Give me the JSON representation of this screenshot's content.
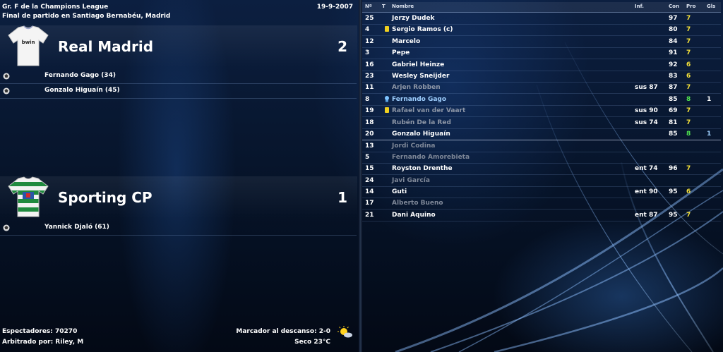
{
  "match": {
    "competition": "Gr. F de la Champions League",
    "subtitle": "Final de partido en Santiago Bernabéu, Madrid",
    "date": "19-9-2007"
  },
  "home": {
    "name": "Real Madrid",
    "score": "2",
    "shirt_icon": "white-shirt-icon",
    "shirt_text": "bwin",
    "events": [
      {
        "text": "Fernando Gago (34)",
        "icon": "goal-ball-icon"
      },
      {
        "text": "Gonzalo Higuaín (45)",
        "icon": "goal-ball-icon"
      }
    ]
  },
  "away": {
    "name": "Sporting CP",
    "score": "1",
    "shirt_icon": "green-hooped-shirt-icon",
    "events": [
      {
        "text": "Yannick Djaló (61)",
        "icon": "goal-ball-icon"
      }
    ]
  },
  "footer": {
    "spectators": "Espectadores: 70270",
    "referee": "Arbitrado por: Riley, M",
    "halftime": "Marcador al descanso: 2-0",
    "weather": "Seco 23°C",
    "weather_icon": "sun-cloud-icon"
  },
  "table": {
    "headers": {
      "num": "Nº",
      "t": "T",
      "name": "Nombre",
      "inf": "Inf.",
      "con": "Con",
      "pro": "Pro",
      "gls": "Gls"
    },
    "rows": [
      {
        "num": "25",
        "name": "Jerzy Dudek",
        "inf": "",
        "con": "97",
        "pro": "7",
        "gls": "",
        "state": "normal",
        "icon": ""
      },
      {
        "num": "4",
        "name": "Sergio Ramos (c)",
        "inf": "",
        "con": "80",
        "pro": "7",
        "gls": "",
        "state": "normal",
        "icon": "yellow-card-icon"
      },
      {
        "num": "12",
        "name": "Marcelo",
        "inf": "",
        "con": "84",
        "pro": "7",
        "gls": "",
        "state": "normal",
        "icon": ""
      },
      {
        "num": "3",
        "name": "Pepe",
        "inf": "",
        "con": "91",
        "pro": "7",
        "gls": "",
        "state": "normal",
        "icon": ""
      },
      {
        "num": "16",
        "name": "Gabriel Heinze",
        "inf": "",
        "con": "92",
        "pro": "6",
        "gls": "",
        "state": "normal",
        "icon": ""
      },
      {
        "num": "23",
        "name": "Wesley Sneijder",
        "inf": "",
        "con": "83",
        "pro": "6",
        "gls": "",
        "state": "normal",
        "icon": ""
      },
      {
        "num": "11",
        "name": "Arjen Robben",
        "inf": "sus 87",
        "con": "87",
        "pro": "7",
        "gls": "",
        "state": "sub-out",
        "icon": ""
      },
      {
        "num": "8",
        "name": "Fernando Gago",
        "inf": "",
        "con": "85",
        "pro": "8",
        "gls": "1",
        "state": "gago",
        "icon": "player-of-match-icon"
      },
      {
        "num": "19",
        "name": "Rafael van der Vaart",
        "inf": "sus 90",
        "con": "69",
        "pro": "7",
        "gls": "",
        "state": "sub-out",
        "icon": "yellow-card-icon"
      },
      {
        "num": "18",
        "name": "Rubén De la Red",
        "inf": "sus 74",
        "con": "81",
        "pro": "7",
        "gls": "",
        "state": "sub-out",
        "icon": ""
      },
      {
        "num": "20",
        "name": "Gonzalo Higuaín",
        "inf": "",
        "con": "85",
        "pro": "8",
        "gls": "1",
        "state": "normal",
        "icon": ""
      },
      {
        "num": "13",
        "name": "Jordi Codina",
        "inf": "",
        "con": "",
        "pro": "",
        "gls": "",
        "state": "unused",
        "icon": ""
      },
      {
        "num": "5",
        "name": "Fernando Amorebieta",
        "inf": "",
        "con": "",
        "pro": "",
        "gls": "",
        "state": "unused",
        "icon": ""
      },
      {
        "num": "15",
        "name": "Royston Drenthe",
        "inf": "ent 74",
        "con": "96",
        "pro": "7",
        "gls": "",
        "state": "normal",
        "icon": ""
      },
      {
        "num": "24",
        "name": "Javi García",
        "inf": "",
        "con": "",
        "pro": "",
        "gls": "",
        "state": "unused",
        "icon": ""
      },
      {
        "num": "14",
        "name": "Guti",
        "inf": "ent 90",
        "con": "95",
        "pro": "6",
        "gls": "",
        "state": "normal",
        "icon": ""
      },
      {
        "num": "17",
        "name": "Alberto Bueno",
        "inf": "",
        "con": "",
        "pro": "",
        "gls": "",
        "state": "unused",
        "icon": ""
      },
      {
        "num": "21",
        "name": "Dani Aquino",
        "inf": "ent 87",
        "con": "95",
        "pro": "7",
        "gls": "",
        "state": "normal",
        "icon": ""
      }
    ]
  }
}
